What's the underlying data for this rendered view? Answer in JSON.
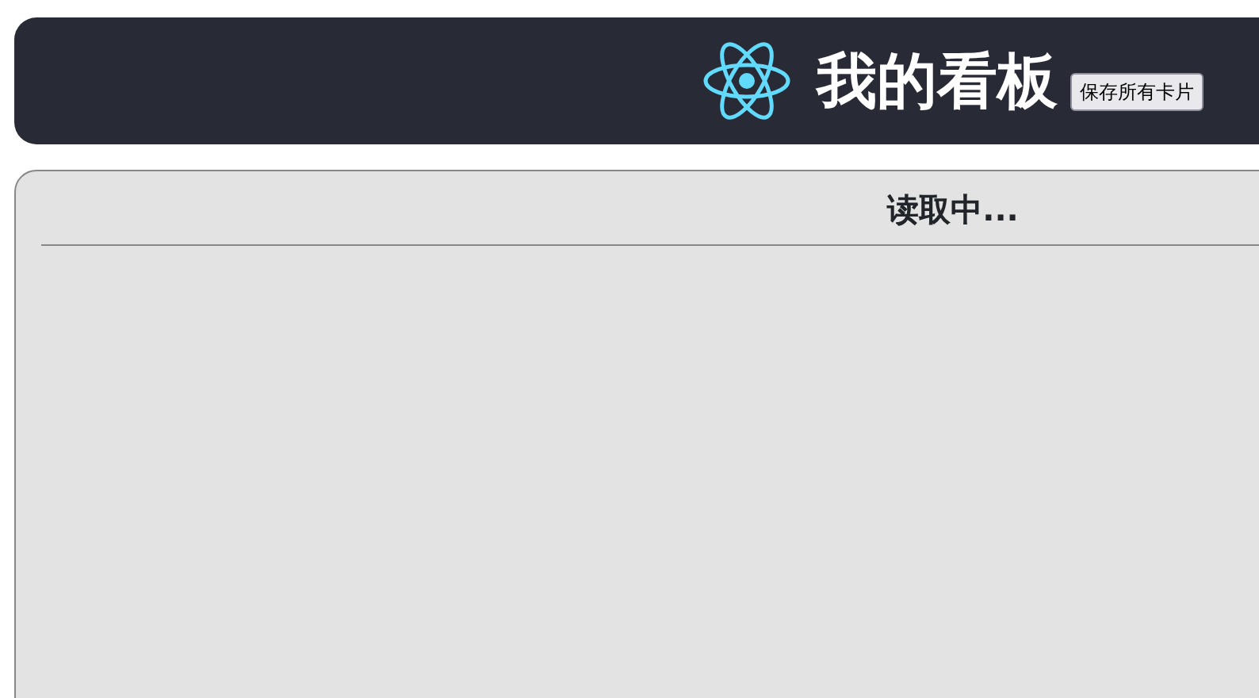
{
  "header": {
    "title": "我的看板",
    "save_button": "保存所有卡片"
  },
  "panel": {
    "status": "读取中..."
  }
}
